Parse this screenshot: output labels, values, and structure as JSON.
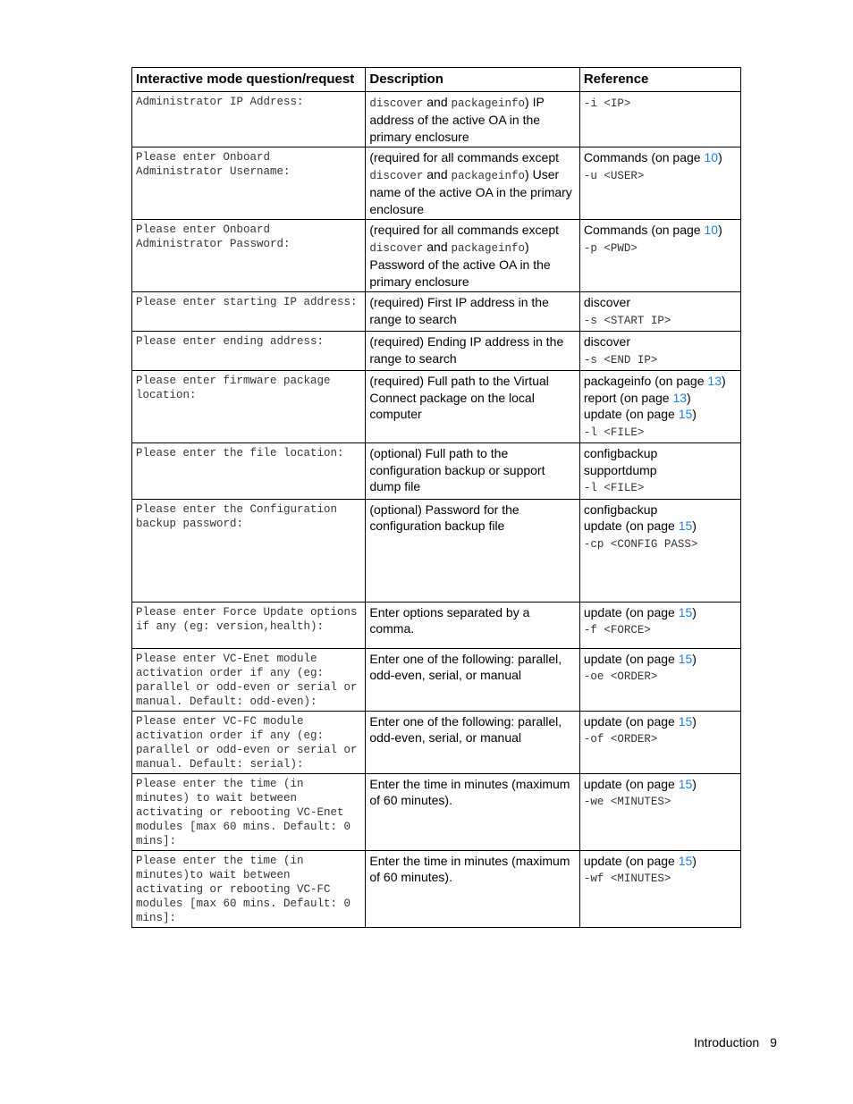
{
  "table": {
    "headers": [
      "Interactive mode question/request",
      "Description",
      "Reference"
    ],
    "rows": [
      {
        "question": "Administrator IP Address:",
        "description": [
          {
            "t": "discover",
            "mono": true
          },
          {
            "t": " and "
          },
          {
            "t": "packageinfo",
            "mono": true
          },
          {
            "t": ") IP address of the active OA in the primary enclosure"
          }
        ],
        "reference": [
          {
            "parts": [
              {
                "t": "-i <IP>",
                "mono": true
              }
            ]
          }
        ]
      },
      {
        "question": "Please enter Onboard Administrator Username:",
        "description": [
          {
            "t": "(required for all commands except "
          },
          {
            "t": "discover",
            "mono": true
          },
          {
            "t": " and "
          },
          {
            "t": "packageinfo",
            "mono": true
          },
          {
            "t": ") User name of the active OA in the primary enclosure"
          }
        ],
        "reference": [
          {
            "parts": [
              {
                "t": "Commands (on page "
              },
              {
                "t": "10",
                "link": true
              },
              {
                "t": ")"
              }
            ]
          },
          {
            "parts": [
              {
                "t": "-u <USER>",
                "mono": true
              }
            ]
          }
        ]
      },
      {
        "question": "Please enter Onboard Administrator Password:",
        "description": [
          {
            "t": "(required for all commands except "
          },
          {
            "t": "discover",
            "mono": true
          },
          {
            "t": " and "
          },
          {
            "t": "packageinfo",
            "mono": true
          },
          {
            "t": ") Password of the active OA in the primary enclosure"
          }
        ],
        "reference": [
          {
            "parts": [
              {
                "t": "Commands (on page "
              },
              {
                "t": "10",
                "link": true
              },
              {
                "t": ")"
              }
            ]
          },
          {
            "parts": [
              {
                "t": "-p <PWD>",
                "mono": true
              }
            ]
          }
        ]
      },
      {
        "question": "Please enter starting IP address:",
        "description": [
          {
            "t": "(required) First IP address in the range to search"
          }
        ],
        "reference": [
          {
            "parts": [
              {
                "t": "discover"
              }
            ]
          },
          {
            "parts": [
              {
                "t": "-s <START IP>",
                "mono": true
              }
            ]
          }
        ]
      },
      {
        "question": "Please enter ending address:",
        "description": [
          {
            "t": "(required) Ending IP address in the range to search"
          }
        ],
        "reference": [
          {
            "parts": [
              {
                "t": "discover"
              }
            ]
          },
          {
            "parts": [
              {
                "t": "-s <END IP>",
                "mono": true
              }
            ]
          }
        ]
      },
      {
        "question": "Please enter firmware package location:",
        "description": [
          {
            "t": "(required) Full path to the Virtual Connect package on the local computer"
          }
        ],
        "reference": [
          {
            "parts": [
              {
                "t": "packageinfo (on page "
              },
              {
                "t": "13",
                "link": true
              },
              {
                "t": ")"
              }
            ]
          },
          {
            "parts": [
              {
                "t": "report (on page "
              },
              {
                "t": "13",
                "link": true
              },
              {
                "t": ")"
              }
            ]
          },
          {
            "parts": [
              {
                "t": "update (on page "
              },
              {
                "t": "15",
                "link": true
              },
              {
                "t": ")"
              }
            ]
          },
          {
            "parts": [
              {
                "t": "-l <FILE>",
                "mono": true
              }
            ]
          }
        ]
      },
      {
        "question": "Please enter the file location:",
        "description": [
          {
            "t": "(optional) Full path to the configuration backup or support dump file"
          }
        ],
        "reference": [
          {
            "parts": [
              {
                "t": "configbackup"
              }
            ]
          },
          {
            "parts": [
              {
                "t": "supportdump"
              }
            ]
          },
          {
            "parts": [
              {
                "t": "-l <FILE>",
                "mono": true
              }
            ]
          }
        ]
      },
      {
        "question": "Please enter the Configuration backup password:",
        "description": [
          {
            "t": "(optional) Password for the configuration backup file"
          }
        ],
        "reference": [
          {
            "parts": [
              {
                "t": "configbackup"
              }
            ]
          },
          {
            "parts": [
              {
                "t": "update (on page "
              },
              {
                "t": "15",
                "link": true
              },
              {
                "t": ")"
              }
            ]
          },
          {
            "parts": [
              {
                "t": "-cp <CONFIG PASS>",
                "mono": true
              }
            ]
          }
        ]
      },
      {
        "question": "Please enter Force Update options if any (eg: version,health):",
        "description": [
          {
            "t": "Enter options separated by a comma."
          }
        ],
        "reference": [
          {
            "parts": [
              {
                "t": "update (on page "
              },
              {
                "t": "15",
                "link": true
              },
              {
                "t": ")"
              }
            ]
          },
          {
            "parts": [
              {
                "t": "-f <FORCE>",
                "mono": true
              }
            ]
          }
        ]
      },
      {
        "question": "Please enter VC-Enet module activation order if any (eg: parallel or odd-even or serial or manual. Default: odd-even):",
        "description": [
          {
            "t": "Enter one of the following: parallel, odd-even, serial, or manual"
          }
        ],
        "reference": [
          {
            "parts": [
              {
                "t": "update (on page "
              },
              {
                "t": "15",
                "link": true
              },
              {
                "t": ")"
              }
            ]
          },
          {
            "parts": [
              {
                "t": "-oe <ORDER>",
                "mono": true
              }
            ]
          }
        ]
      },
      {
        "question": "Please enter VC-FC module activation order if any (eg: parallel or odd-even or serial or manual. Default: serial):",
        "description": [
          {
            "t": "Enter one of the following: parallel, odd-even, serial, or manual"
          }
        ],
        "reference": [
          {
            "parts": [
              {
                "t": "update (on page "
              },
              {
                "t": "15",
                "link": true
              },
              {
                "t": ")"
              }
            ]
          },
          {
            "parts": [
              {
                "t": "-of <ORDER>",
                "mono": true
              }
            ]
          }
        ]
      },
      {
        "question": "Please enter the time (in minutes) to wait between activating or rebooting VC-Enet modules [max 60 mins. Default: 0 mins]:",
        "description": [
          {
            "t": "Enter the time in minutes (maximum of 60 minutes)."
          }
        ],
        "reference": [
          {
            "parts": [
              {
                "t": "update (on page "
              },
              {
                "t": "15",
                "link": true
              },
              {
                "t": ")"
              }
            ]
          },
          {
            "parts": [
              {
                "t": "-we <MINUTES>",
                "mono": true
              }
            ]
          }
        ]
      },
      {
        "question": "Please enter the time (in minutes)to wait between activating or rebooting VC-FC modules [max 60 mins. Default: 0 mins]:",
        "description": [
          {
            "t": "Enter the time in minutes (maximum of 60 minutes)."
          }
        ],
        "reference": [
          {
            "parts": [
              {
                "t": "update (on page "
              },
              {
                "t": "15",
                "link": true
              },
              {
                "t": ")"
              }
            ]
          },
          {
            "parts": [
              {
                "t": "-wf <MINUTES>",
                "mono": true
              }
            ]
          }
        ]
      }
    ]
  },
  "footer": {
    "section": "Introduction",
    "page_number": "9"
  },
  "colors": {
    "link": "#1f7fdc"
  }
}
